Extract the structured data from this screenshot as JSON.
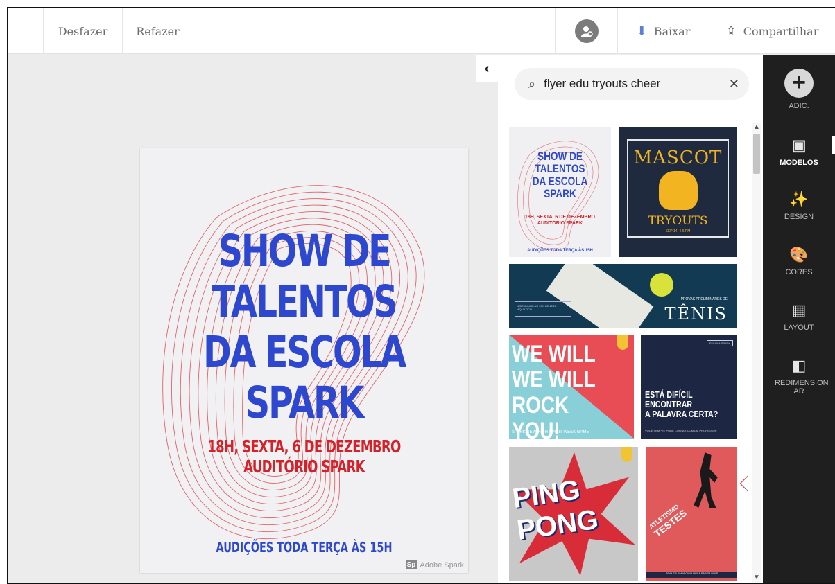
{
  "toolbar": {
    "undo": "Desfazer",
    "redo": "Refazer",
    "download": "Baixar",
    "share": "Compartilhar"
  },
  "poster": {
    "title_lines": [
      "SHOW DE",
      "TALENTOS",
      "DA ESCOLA",
      "SPARK"
    ],
    "subtitle_lines": [
      "18H, SEXTA, 6 DE DEZEMBRO",
      "AUDITÓRIO SPARK"
    ],
    "footer": "AUDIÇÕES TODA TERÇA ÀS 15H",
    "watermark_badge": "Sp",
    "watermark_text": "Adobe Spark"
  },
  "panel": {
    "search_value": "flyer edu tryouts cheer",
    "templates": [
      {
        "title_lines": [
          "SHOW DE",
          "TALENTOS",
          "DA ESCOLA",
          "SPARK"
        ],
        "sub_lines": [
          "18H, SEXTA, 6 DE DEZEMBRO",
          "AUDITÓRIO SPARK"
        ],
        "foot": "AUDIÇÕES TODA TERÇA ÀS 15H"
      },
      {
        "title": "MASCOT",
        "sub": "TRYOUTS",
        "date": "SEP 14, 4-6 PM"
      },
      {
        "left_text": "4 DE JUNHO AS 10H CENTRO AQUÁTICO",
        "tag": "PROVAS PRELIMINARES DE",
        "title": "TÊNIS"
      },
      {
        "lines": [
          "WE WILL",
          "WE WILL",
          "ROCK YOU!"
        ],
        "foot": "SPARKVIEW HIGH SPIRIT WEEK GAME"
      },
      {
        "tag": "ESCOLA SPARK",
        "lines": [
          "ESTÁ DIFÍCIL",
          "ENCONTRAR",
          "A PALAVRA CERTA?"
        ],
        "foot": "VOCÊ SEMPRE PODE CONTAR COM UM PROFESSOR"
      },
      {
        "lines": [
          "PING",
          "PONG"
        ]
      },
      {
        "lines": [
          "ATLETISMO",
          "TESTES"
        ],
        "foot": "ROLLER PARA CIMA PARA SABER MAIS"
      }
    ]
  },
  "rail": {
    "add": "ADIC.",
    "items": [
      "MODELOS",
      "DESIGN",
      "CORES",
      "LAYOUT",
      "REDIMENSION AR"
    ],
    "active": "MODELOS"
  },
  "colors": {
    "poster_blue": "#2d48cf",
    "poster_red": "#d4222a",
    "rail_bg": "#1f1f1f",
    "download_accent": "#5b7fd6"
  },
  "icons": [
    "user-icon",
    "download-icon",
    "share-icon",
    "chevron-left-icon",
    "search-icon",
    "close-icon",
    "plus-icon",
    "templates-icon",
    "wand-icon",
    "palette-icon",
    "layout-icon",
    "resize-icon"
  ]
}
